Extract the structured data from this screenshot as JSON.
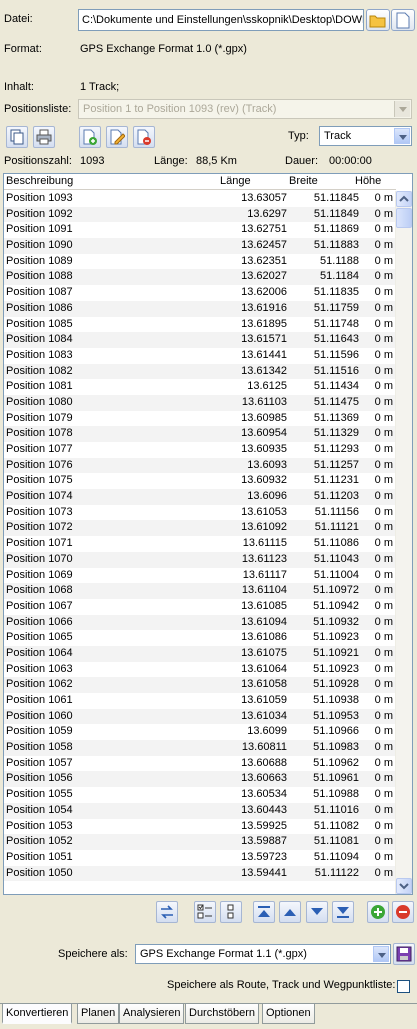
{
  "file": {
    "label": "Datei:",
    "path": "C:\\Dokumente und Einstellungen\\sskopnik\\Desktop\\DOWNL"
  },
  "format": {
    "label": "Format:",
    "value": "GPS Exchange Format 1.0 (*.gpx)"
  },
  "content": {
    "label": "Inhalt:",
    "value": "1 Track;"
  },
  "positionlist": {
    "label": "Positionsliste:",
    "value": "Position 1 to Position 1093 (rev) (Track)"
  },
  "type": {
    "label": "Typ:",
    "value": "Track"
  },
  "stats": {
    "count_label": "Positionszahl:",
    "count_value": "1093",
    "length_label": "Länge:",
    "length_value": "88,5 Km",
    "duration_label": "Dauer:",
    "duration_value": "00:00:00"
  },
  "table": {
    "headers": [
      "Beschreibung",
      "Länge",
      "Breite",
      "Höhe"
    ],
    "rows": [
      [
        "Position 1093",
        "13.63057",
        "51.11845",
        "0 m"
      ],
      [
        "Position 1092",
        "13.6297",
        "51.11849",
        "0 m"
      ],
      [
        "Position 1091",
        "13.62751",
        "51.11869",
        "0 m"
      ],
      [
        "Position 1090",
        "13.62457",
        "51.11883",
        "0 m"
      ],
      [
        "Position 1089",
        "13.62351",
        "51.1188",
        "0 m"
      ],
      [
        "Position 1088",
        "13.62027",
        "51.1184",
        "0 m"
      ],
      [
        "Position 1087",
        "13.62006",
        "51.11835",
        "0 m"
      ],
      [
        "Position 1086",
        "13.61916",
        "51.11759",
        "0 m"
      ],
      [
        "Position 1085",
        "13.61895",
        "51.11748",
        "0 m"
      ],
      [
        "Position 1084",
        "13.61571",
        "51.11643",
        "0 m"
      ],
      [
        "Position 1083",
        "13.61441",
        "51.11596",
        "0 m"
      ],
      [
        "Position 1082",
        "13.61342",
        "51.11516",
        "0 m"
      ],
      [
        "Position 1081",
        "13.6125",
        "51.11434",
        "0 m"
      ],
      [
        "Position 1080",
        "13.61103",
        "51.11475",
        "0 m"
      ],
      [
        "Position 1079",
        "13.60985",
        "51.11369",
        "0 m"
      ],
      [
        "Position 1078",
        "13.60954",
        "51.11329",
        "0 m"
      ],
      [
        "Position 1077",
        "13.60935",
        "51.11293",
        "0 m"
      ],
      [
        "Position 1076",
        "13.6093",
        "51.11257",
        "0 m"
      ],
      [
        "Position 1075",
        "13.60932",
        "51.11231",
        "0 m"
      ],
      [
        "Position 1074",
        "13.6096",
        "51.11203",
        "0 m"
      ],
      [
        "Position 1073",
        "13.61053",
        "51.11156",
        "0 m"
      ],
      [
        "Position 1072",
        "13.61092",
        "51.11121",
        "0 m"
      ],
      [
        "Position 1071",
        "13.61115",
        "51.11086",
        "0 m"
      ],
      [
        "Position 1070",
        "13.61123",
        "51.11043",
        "0 m"
      ],
      [
        "Position 1069",
        "13.61117",
        "51.11004",
        "0 m"
      ],
      [
        "Position 1068",
        "13.61104",
        "51.10972",
        "0 m"
      ],
      [
        "Position 1067",
        "13.61085",
        "51.10942",
        "0 m"
      ],
      [
        "Position 1066",
        "13.61094",
        "51.10932",
        "0 m"
      ],
      [
        "Position 1065",
        "13.61086",
        "51.10923",
        "0 m"
      ],
      [
        "Position 1064",
        "13.61075",
        "51.10921",
        "0 m"
      ],
      [
        "Position 1063",
        "13.61064",
        "51.10923",
        "0 m"
      ],
      [
        "Position 1062",
        "13.61058",
        "51.10928",
        "0 m"
      ],
      [
        "Position 1061",
        "13.61059",
        "51.10938",
        "0 m"
      ],
      [
        "Position 1060",
        "13.61034",
        "51.10953",
        "0 m"
      ],
      [
        "Position 1059",
        "13.6099",
        "51.10966",
        "0 m"
      ],
      [
        "Position 1058",
        "13.60811",
        "51.10983",
        "0 m"
      ],
      [
        "Position 1057",
        "13.60688",
        "51.10962",
        "0 m"
      ],
      [
        "Position 1056",
        "13.60663",
        "51.10961",
        "0 m"
      ],
      [
        "Position 1055",
        "13.60534",
        "51.10988",
        "0 m"
      ],
      [
        "Position 1054",
        "13.60443",
        "51.11016",
        "0 m"
      ],
      [
        "Position 1053",
        "13.59925",
        "51.11082",
        "0 m"
      ],
      [
        "Position 1052",
        "13.59887",
        "51.11081",
        "0 m"
      ],
      [
        "Position 1051",
        "13.59723",
        "51.11094",
        "0 m"
      ],
      [
        "Position 1050",
        "13.59441",
        "51.11122",
        "0 m"
      ]
    ]
  },
  "save": {
    "label": "Speichere als:",
    "value": "GPS Exchange Format 1.1 (*.gpx)"
  },
  "save_option": {
    "label": "Speichere als Route, Track und Wegpunktliste:"
  },
  "tabs": [
    "Konvertieren",
    "Planen",
    "Analysieren",
    "Durchstöbern",
    "Optionen"
  ],
  "colors": {
    "accent": "#316ac5",
    "folder": "#f5c342",
    "add": "#3aa636",
    "remove": "#d93a2b"
  }
}
